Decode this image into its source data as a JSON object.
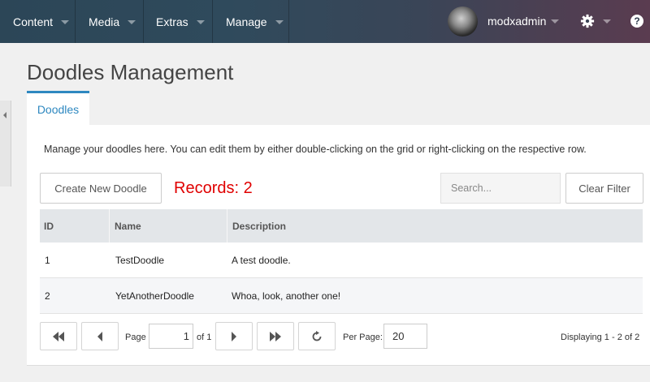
{
  "nav": {
    "items": [
      {
        "label": "Content"
      },
      {
        "label": "Media"
      },
      {
        "label": "Extras"
      },
      {
        "label": "Manage"
      }
    ],
    "username": "modxadmin",
    "help_glyph": "?"
  },
  "page": {
    "title": "Doodles Management",
    "tab_label": "Doodles",
    "intro": "Manage your doodles here. You can edit them by either double-clicking on the grid or right-clicking on the respective row."
  },
  "toolbar": {
    "create_label": "Create New Doodle",
    "records_label": "Records: 2",
    "search_placeholder": "Search...",
    "clear_label": "Clear Filter"
  },
  "grid": {
    "columns": [
      "ID",
      "Name",
      "Description"
    ],
    "rows": [
      {
        "id": "1",
        "name": "TestDoodle",
        "description": "A test doodle."
      },
      {
        "id": "2",
        "name": "YetAnotherDoodle",
        "description": "Whoa, look, another one!"
      }
    ]
  },
  "pager": {
    "page_label": "Page",
    "page_value": "1",
    "of_label": "of 1",
    "per_page_label": "Per Page:",
    "per_page_value": "20",
    "displaying": "Displaying 1 - 2 of 2"
  },
  "colors": {
    "accent": "#2e88c0",
    "records": "#e00000",
    "nav_bg": "#2f4a5c"
  },
  "icons": [
    "chevron-down-icon",
    "gear-icon",
    "help-icon",
    "first-page-icon",
    "prev-page-icon",
    "next-page-icon",
    "last-page-icon",
    "refresh-icon",
    "collapse-arrow-icon"
  ]
}
